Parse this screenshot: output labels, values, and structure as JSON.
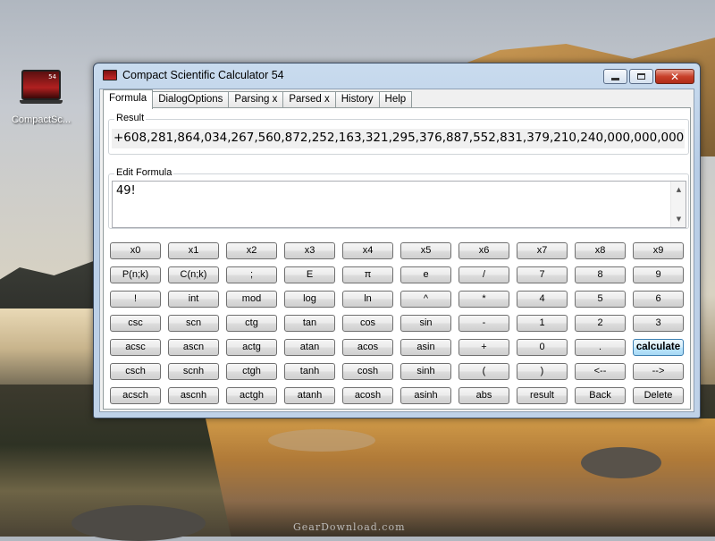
{
  "desktop": {
    "icon_label": "CompactSc...",
    "icon_badge": "54",
    "watermark": "GearDownload.com"
  },
  "window": {
    "title": "Compact Scientific Calculator 54",
    "controls": {
      "minimize": "",
      "maximize": "",
      "close": "✕"
    }
  },
  "tabs": [
    "Formula",
    "DialogOptions",
    "Parsing x",
    "Parsed x",
    "History",
    "Help"
  ],
  "active_tab": "Formula",
  "result": {
    "label": "Result",
    "value": "+608,281,864,034,267,560,872,252,163,321,295,376,887,552,831,379,210,240,000,000,000"
  },
  "edit_formula": {
    "label": "Edit Formula",
    "value": "49!"
  },
  "keypad": {
    "rows": [
      [
        "x0",
        "x1",
        "x2",
        "x3",
        "x4",
        "x5",
        "x6",
        "x7",
        "x8",
        "x9"
      ],
      [
        "P(n;k)",
        "C(n;k)",
        ";",
        "E",
        "π",
        "e",
        "/",
        "7",
        "8",
        "9"
      ],
      [
        "!",
        "int",
        "mod",
        "log",
        "ln",
        "^",
        "*",
        "4",
        "5",
        "6"
      ],
      [
        "csc",
        "scn",
        "ctg",
        "tan",
        "cos",
        "sin",
        "-",
        "1",
        "2",
        "3"
      ],
      [
        "acsc",
        "ascn",
        "actg",
        "atan",
        "acos",
        "asin",
        "+",
        "0",
        ".",
        "calculate"
      ],
      [
        "csch",
        "scnh",
        "ctgh",
        "tanh",
        "cosh",
        "sinh",
        "(",
        ")",
        "<--",
        "-->"
      ],
      [
        "acsch",
        "ascnh",
        "actgh",
        "atanh",
        "acosh",
        "asinh",
        "abs",
        "result",
        "Back",
        "Delete"
      ]
    ],
    "primary_key": "calculate"
  }
}
